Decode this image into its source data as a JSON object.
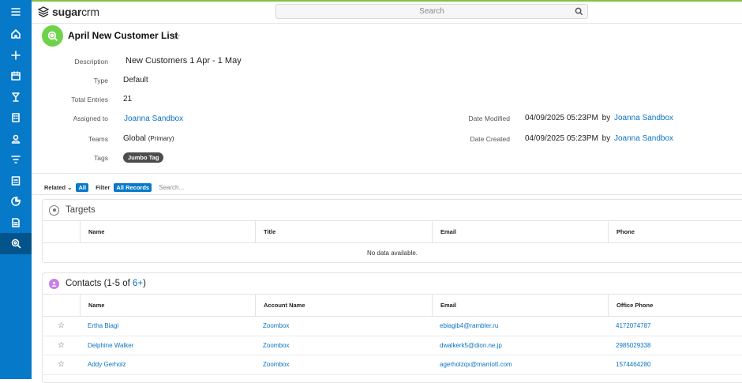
{
  "app": {
    "logo_bold": "sugar",
    "logo_light": "crm"
  },
  "search": {
    "placeholder": "Search"
  },
  "sidebar": {
    "items": [
      "menu",
      "home",
      "add",
      "calendar",
      "opportunities",
      "accounts",
      "contacts",
      "filter",
      "reports",
      "dashboards",
      "documents",
      "target-lists"
    ]
  },
  "record": {
    "title": "April New Customer List",
    "fields": {
      "description_label": "Description",
      "description": "New Customers 1 Apr - 1 May",
      "type_label": "Type",
      "type": "Default",
      "total_label": "Total Entries",
      "total": "21",
      "assigned_label": "Assigned to",
      "assigned": "Joanna Sandbox",
      "teams_label": "Teams",
      "teams": "Global",
      "teams_suffix": "(Primary)",
      "tags_label": "Tags",
      "tag": "Jumbo Tag",
      "modified_label": "Date Modified",
      "modified": "04/09/2025 05:23PM",
      "modified_by_word": "by",
      "modified_by": "Joanna Sandbox",
      "created_label": "Date Created",
      "created": "04/09/2025 05:23PM",
      "created_by_word": "by",
      "created_by": "Joanna Sandbox"
    }
  },
  "filterbar": {
    "related": "Related",
    "all": "All",
    "filter": "Filter",
    "all_records": "All Records",
    "search_placeholder": "Search..."
  },
  "targets": {
    "title": "Targets",
    "columns": [
      "Name",
      "Title",
      "Email",
      "Phone"
    ],
    "empty": "No data available."
  },
  "contacts": {
    "title_prefix": "Contacts (1-5 of ",
    "count_link": "6+",
    "title_suffix": ")",
    "columns": [
      "Name",
      "Account Name",
      "Email",
      "Office Phone"
    ],
    "rows": [
      [
        "Ertha Biagi",
        "Zoombox",
        "ebiagib4@rambler.ru",
        "4172074787"
      ],
      [
        "Delphine Walker",
        "Zoombox",
        "dwalkerk5@dion.ne.jp",
        "2985029338"
      ],
      [
        "Addy Gerholz",
        "Zoombox",
        "agerholzqx@marriott.com",
        "1574464280"
      ]
    ]
  },
  "colors": {
    "sidebar": "#0679c8",
    "accent_green": "#6ed24a",
    "link": "#0b74c4",
    "contacts_icon": "#c97ee8"
  }
}
